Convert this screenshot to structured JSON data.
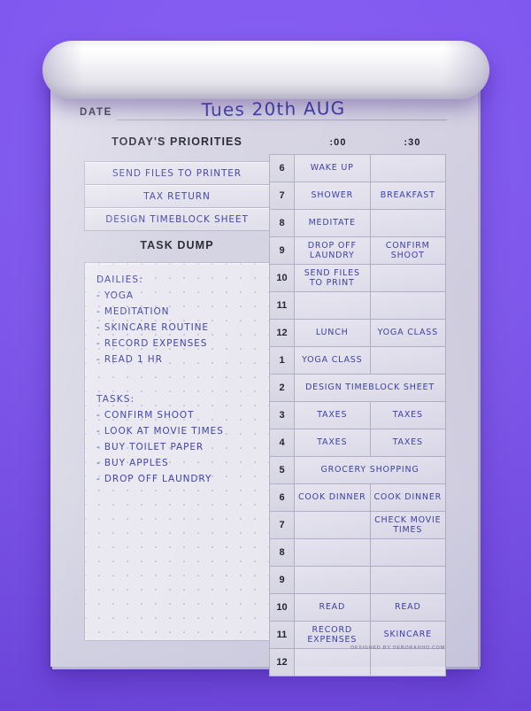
{
  "colors": {
    "background_purple": "#7f56f2",
    "paper": "#d6d5e3",
    "ink_blue": "#3d3fa6",
    "print_black": "#22222d",
    "rule_grey": "#b2b0c6"
  },
  "header": {
    "date_label": "DATE",
    "date_value": "Tues 20th AUG"
  },
  "sections": {
    "priorities_title": "TODAY'S PRIORITIES",
    "task_dump_title": "TASK DUMP"
  },
  "priorities": [
    "SEND FILES TO PRINTER",
    "TAX RETURN",
    "DESIGN TIMEBLOCK SHEET"
  ],
  "task_dump": {
    "groups": [
      {
        "heading": "DAILIES:",
        "items": [
          "- YOGA",
          "- MEDITATION",
          "- SKINCARE ROUTINE",
          "- RECORD EXPENSES",
          "- READ 1 HR"
        ]
      },
      {
        "heading": "TASKS:",
        "items": [
          "- CONFIRM SHOOT",
          "- LOOK AT MOVIE TIMES",
          "- BUY TOILET PAPER",
          "- BUY APPLES",
          "- DROP OFF LAUNDRY"
        ]
      }
    ]
  },
  "schedule": {
    "column_headers": [
      ":00",
      ":30"
    ],
    "rows": [
      {
        "hour": "6",
        "on_hour": "WAKE UP",
        "half_hour": "",
        "span": false
      },
      {
        "hour": "7",
        "on_hour": "SHOWER",
        "half_hour": "BREAKFAST",
        "span": false
      },
      {
        "hour": "8",
        "on_hour": "MEDITATE",
        "half_hour": "",
        "span": false
      },
      {
        "hour": "9",
        "on_hour": "DROP OFF LAUNDRY",
        "half_hour": "CONFIRM SHOOT",
        "span": false
      },
      {
        "hour": "10",
        "on_hour": "SEND FILES TO PRINT",
        "half_hour": "",
        "span": false
      },
      {
        "hour": "11",
        "on_hour": "",
        "half_hour": "",
        "span": false
      },
      {
        "hour": "12",
        "on_hour": "LUNCH",
        "half_hour": "YOGA CLASS",
        "span": false
      },
      {
        "hour": "1",
        "on_hour": "YOGA CLASS",
        "half_hour": "",
        "span": false
      },
      {
        "hour": "2",
        "on_hour": "DESIGN TIMEBLOCK SHEET",
        "half_hour": "",
        "span": true
      },
      {
        "hour": "3",
        "on_hour": "TAXES",
        "half_hour": "TAXES",
        "span": false
      },
      {
        "hour": "4",
        "on_hour": "TAXES",
        "half_hour": "TAXES",
        "span": false
      },
      {
        "hour": "5",
        "on_hour": "GROCERY SHOPPING",
        "half_hour": "",
        "span": true
      },
      {
        "hour": "6",
        "on_hour": "COOK DINNER",
        "half_hour": "COOK DINNER",
        "span": false
      },
      {
        "hour": "7",
        "on_hour": "",
        "half_hour": "CHECK MOVIE TIMES",
        "span": false
      },
      {
        "hour": "8",
        "on_hour": "",
        "half_hour": "",
        "span": false
      },
      {
        "hour": "9",
        "on_hour": "",
        "half_hour": "",
        "span": false
      },
      {
        "hour": "10",
        "on_hour": "READ",
        "half_hour": "READ",
        "span": false
      },
      {
        "hour": "11",
        "on_hour": "RECORD EXPENSES",
        "half_hour": "SKINCARE",
        "span": false
      },
      {
        "hour": "12",
        "on_hour": "",
        "half_hour": "",
        "span": false
      }
    ]
  },
  "credit": "DESIGNED BY DEBORAHHO.COM"
}
